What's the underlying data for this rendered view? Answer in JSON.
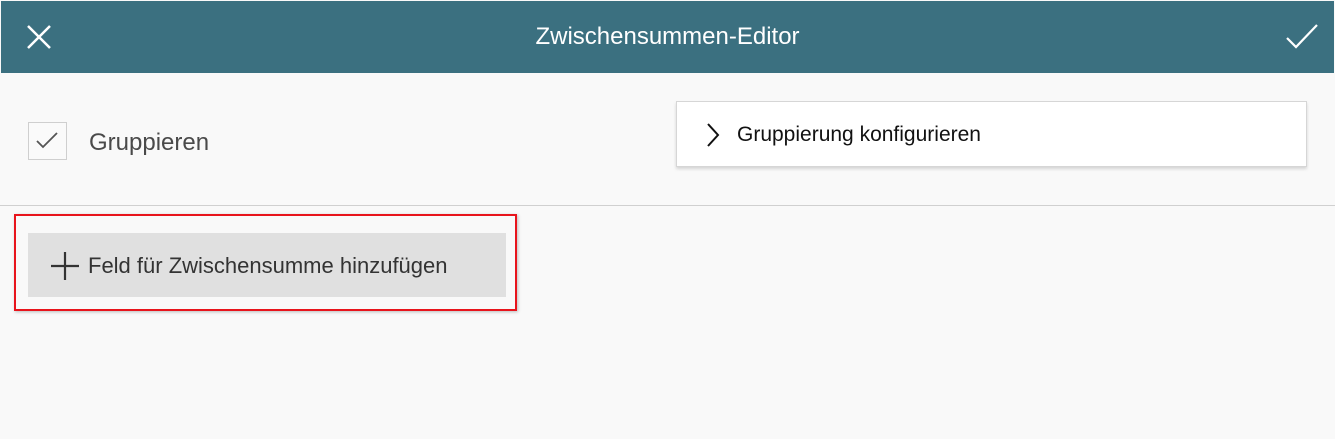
{
  "header": {
    "title": "Zwischensummen-Editor",
    "close_icon": "close-icon",
    "confirm_icon": "check-icon"
  },
  "grouping": {
    "checkbox_label": "Gruppieren",
    "checked": true,
    "configure_label": "Gruppierung konfigurieren"
  },
  "actions": {
    "add_field_label": "Feld für Zwischensumme hinzufügen"
  },
  "colors": {
    "header_bg": "#3b7080",
    "highlight": "#e8141c",
    "button_bg": "#e0e0e0"
  }
}
